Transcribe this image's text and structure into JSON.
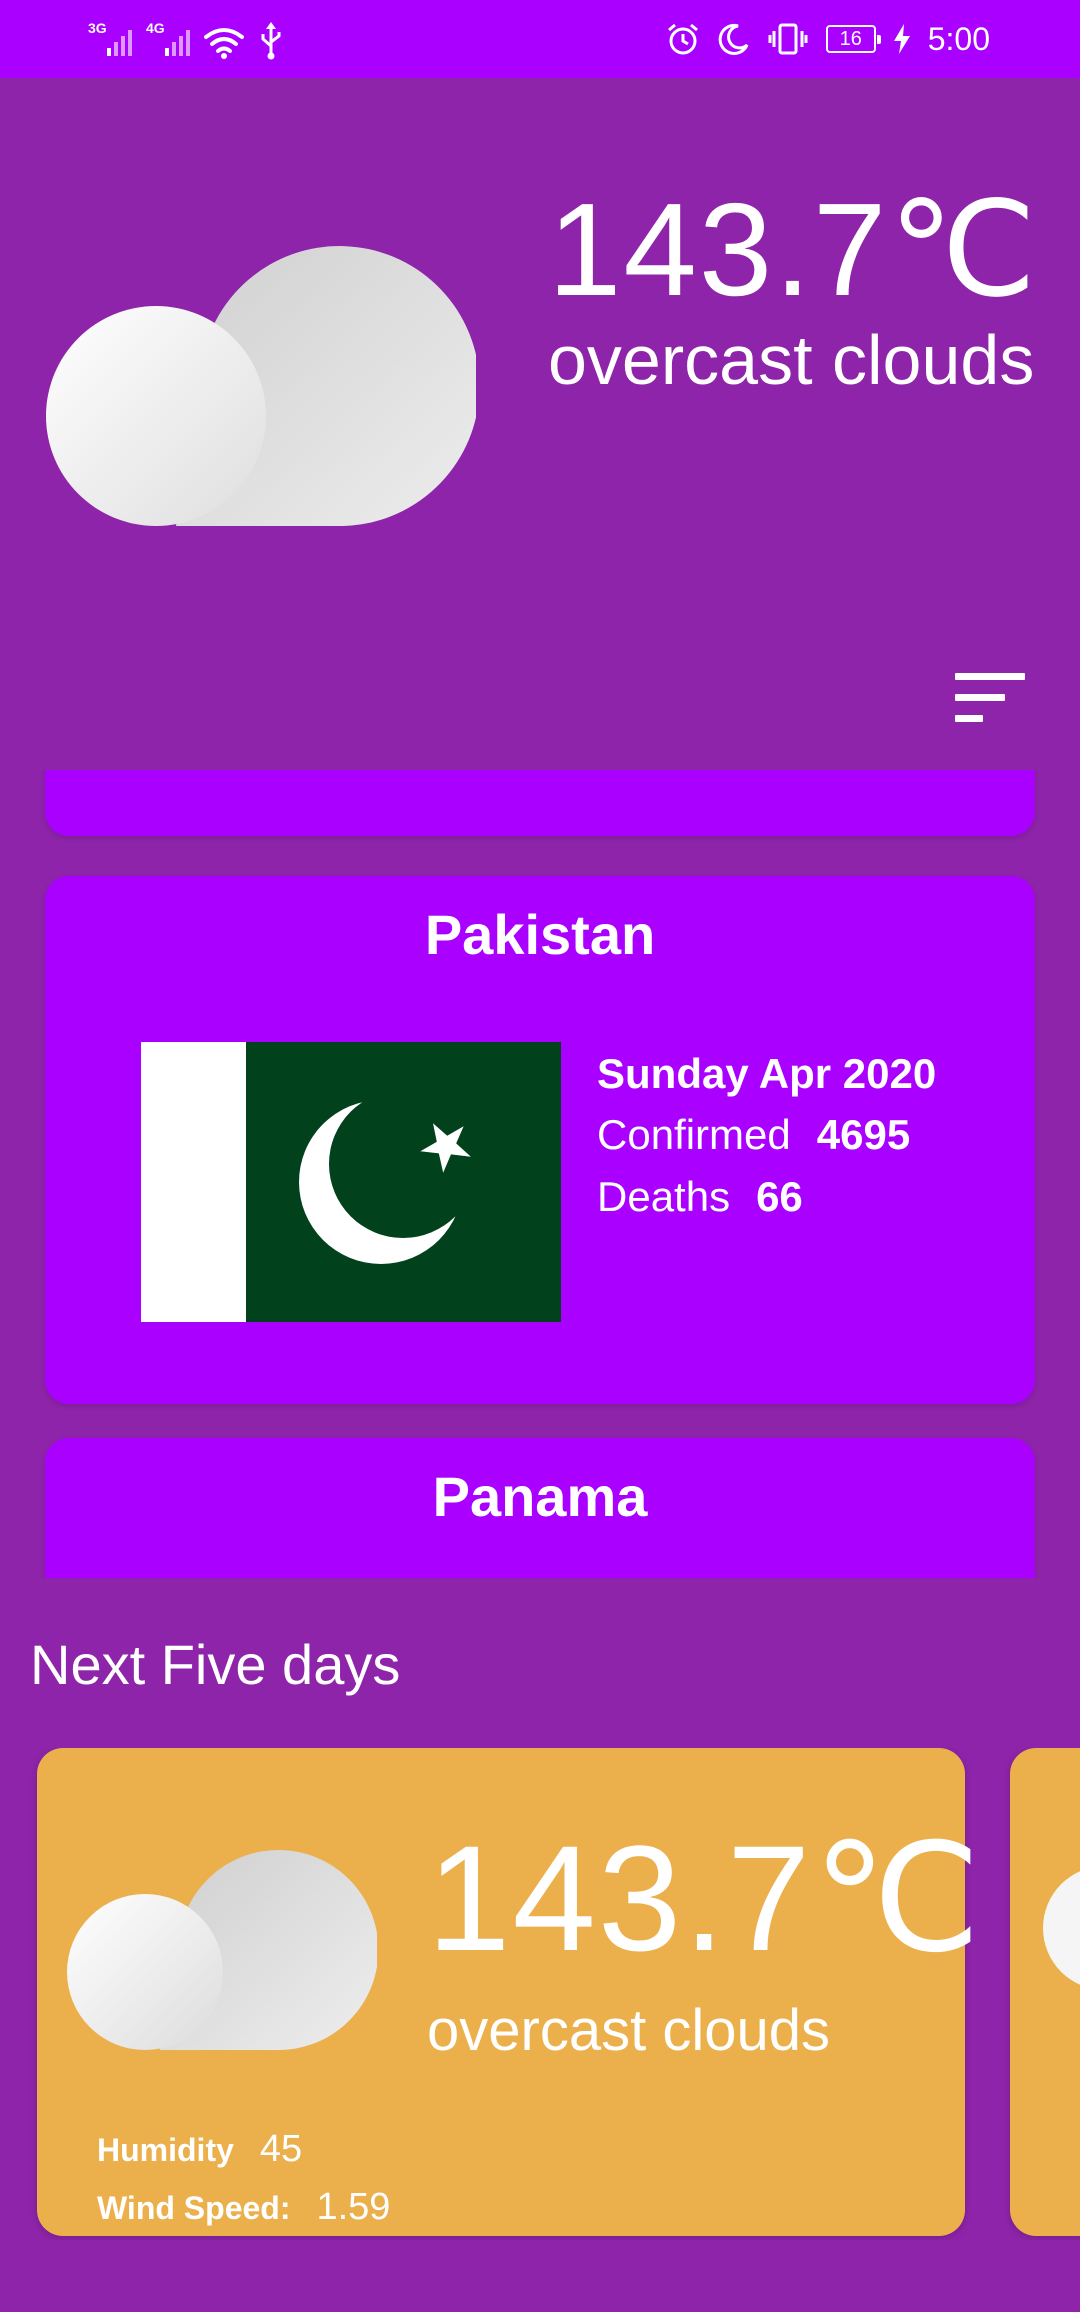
{
  "status_bar": {
    "network_1": "3G",
    "network_2": "4G",
    "battery": "16",
    "time": "5:00"
  },
  "current_weather": {
    "temperature": "143.7℃",
    "description": "overcast clouds",
    "icon": "cloud-icon"
  },
  "sort_button": {
    "icon": "sort-icon"
  },
  "countries": [
    {
      "name": "Pakistan",
      "date": "Sunday Apr 2020",
      "confirmed_label": "Confirmed",
      "confirmed": "4695",
      "deaths_label": "Deaths",
      "deaths": "66"
    },
    {
      "name": "Panama"
    }
  ],
  "forecast": {
    "title": "Next Five days",
    "days": [
      {
        "temperature": "143.7℃",
        "description": "overcast clouds",
        "humidity_label": "Humidity",
        "humidity": "45",
        "wind_label": "Wind Speed:",
        "wind": "1.59",
        "icon": "cloud-icon"
      }
    ]
  },
  "colors": {
    "background": "#8e24aa",
    "accent": "#aa00ff",
    "forecast_card": "#ebb04c",
    "flag_green": "#01411c"
  }
}
